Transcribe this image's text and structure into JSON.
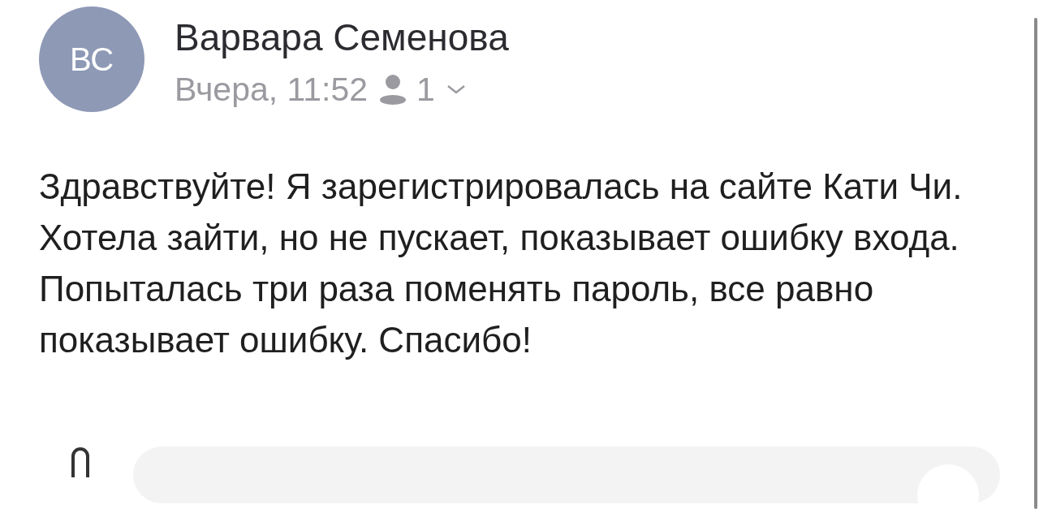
{
  "message": {
    "avatar_initials": "ВС",
    "sender": "Варвара Семенова",
    "time": "Вчера, 11:52",
    "recipients_count": "1",
    "body": "Здравствуйте! Я зарегистрировалась на сайте Кати Чи. Хотела зайти, но не пускает, показывает ошибку входа. Попыталась три раза поменять пароль, все равно показывает ошибку. Спасибо!"
  }
}
